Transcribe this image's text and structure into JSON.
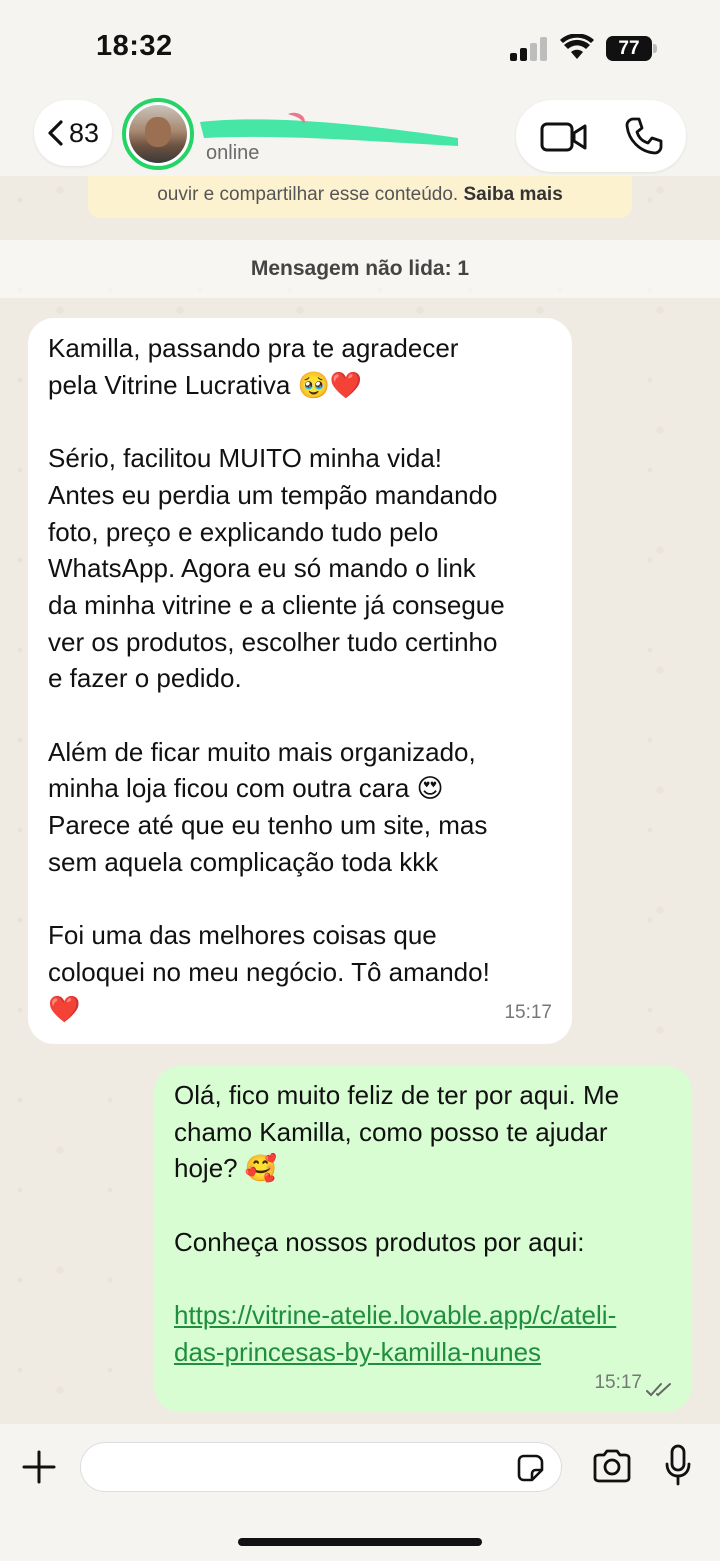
{
  "status_bar": {
    "time": "18:32",
    "battery": "77"
  },
  "header": {
    "back_count": "83",
    "contact_status": "online"
  },
  "notice": {
    "text": "ouvir e compartilhar esse conteúdo.",
    "link": "Saiba mais"
  },
  "unread_divider": "Mensagem não lida: 1",
  "messages": [
    {
      "direction": "incoming",
      "paragraphs": [
        "Kamilla, passando pra te agradecer\npela Vitrine Lucrativa 🥹❤️",
        "Sério, facilitou MUITO minha vida!\nAntes eu perdia um tempão mandando\nfoto, preço e explicando tudo pelo\nWhatsApp. Agora eu só mando o link\nda minha vitrine e a cliente já consegue\nver os produtos, escolher tudo certinho\ne fazer o pedido.",
        "Além de ficar muito mais organizado,\nminha loja ficou com outra cara 😍\nParece até que eu tenho um site, mas\nsem aquela complicação toda kkk",
        "Foi uma das melhores coisas que\ncoloquei no meu negócio. Tô amando!\n❤️"
      ],
      "time": "15:17"
    },
    {
      "direction": "outgoing",
      "paragraphs": [
        "Olá, fico muito feliz de ter por aqui. Me\nchamo Kamilla, como posso te ajudar\nhoje? 🥰",
        "Conheça nossos produtos por aqui:"
      ],
      "link": "https://vitrine-atelie.lovable.app/c/ateli-das-princesas-by-kamilla-nunes",
      "link_display": "https://vitrine-atelie.lovable.app/c/ateli-\ndas-princesas-by-kamilla-nunes",
      "time": "15:17"
    }
  ],
  "colors": {
    "incoming_bubble": "#ffffff",
    "outgoing_bubble": "#d8fdd2",
    "link": "#1f8e3d",
    "avatar_ring": "#25d366",
    "background": "#efeae2"
  },
  "icons": [
    "back-chevron-icon",
    "video-call-icon",
    "phone-call-icon",
    "plus-icon",
    "sticker-icon",
    "camera-icon",
    "mic-icon",
    "double-check-icon"
  ]
}
